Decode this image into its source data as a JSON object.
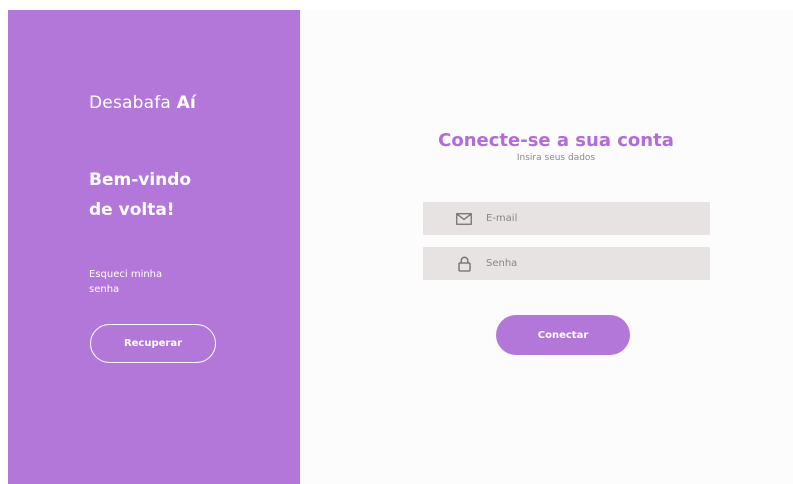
{
  "colors": {
    "accent": "#b377d9",
    "title": "#b36bd6",
    "field_bg": "#e7e3e3",
    "panel_bg": "#fdfcfc"
  },
  "left_panel": {
    "brand_prefix": "Desabafa ",
    "brand_bold": "Aí",
    "welcome_line1": "Bem-vindo",
    "welcome_line2": "de volta!",
    "forgot_line1": "Esqueci minha",
    "forgot_line2": "senha",
    "recover_label": "Recuperar"
  },
  "login": {
    "title": "Conecte-se a sua conta",
    "subtitle": "Insira seus dados",
    "email": {
      "placeholder": "E-mail",
      "value": "",
      "icon": "envelope-icon"
    },
    "password": {
      "placeholder": "Senha",
      "value": "",
      "icon": "lock-icon"
    },
    "connect_label": "Conectar"
  }
}
